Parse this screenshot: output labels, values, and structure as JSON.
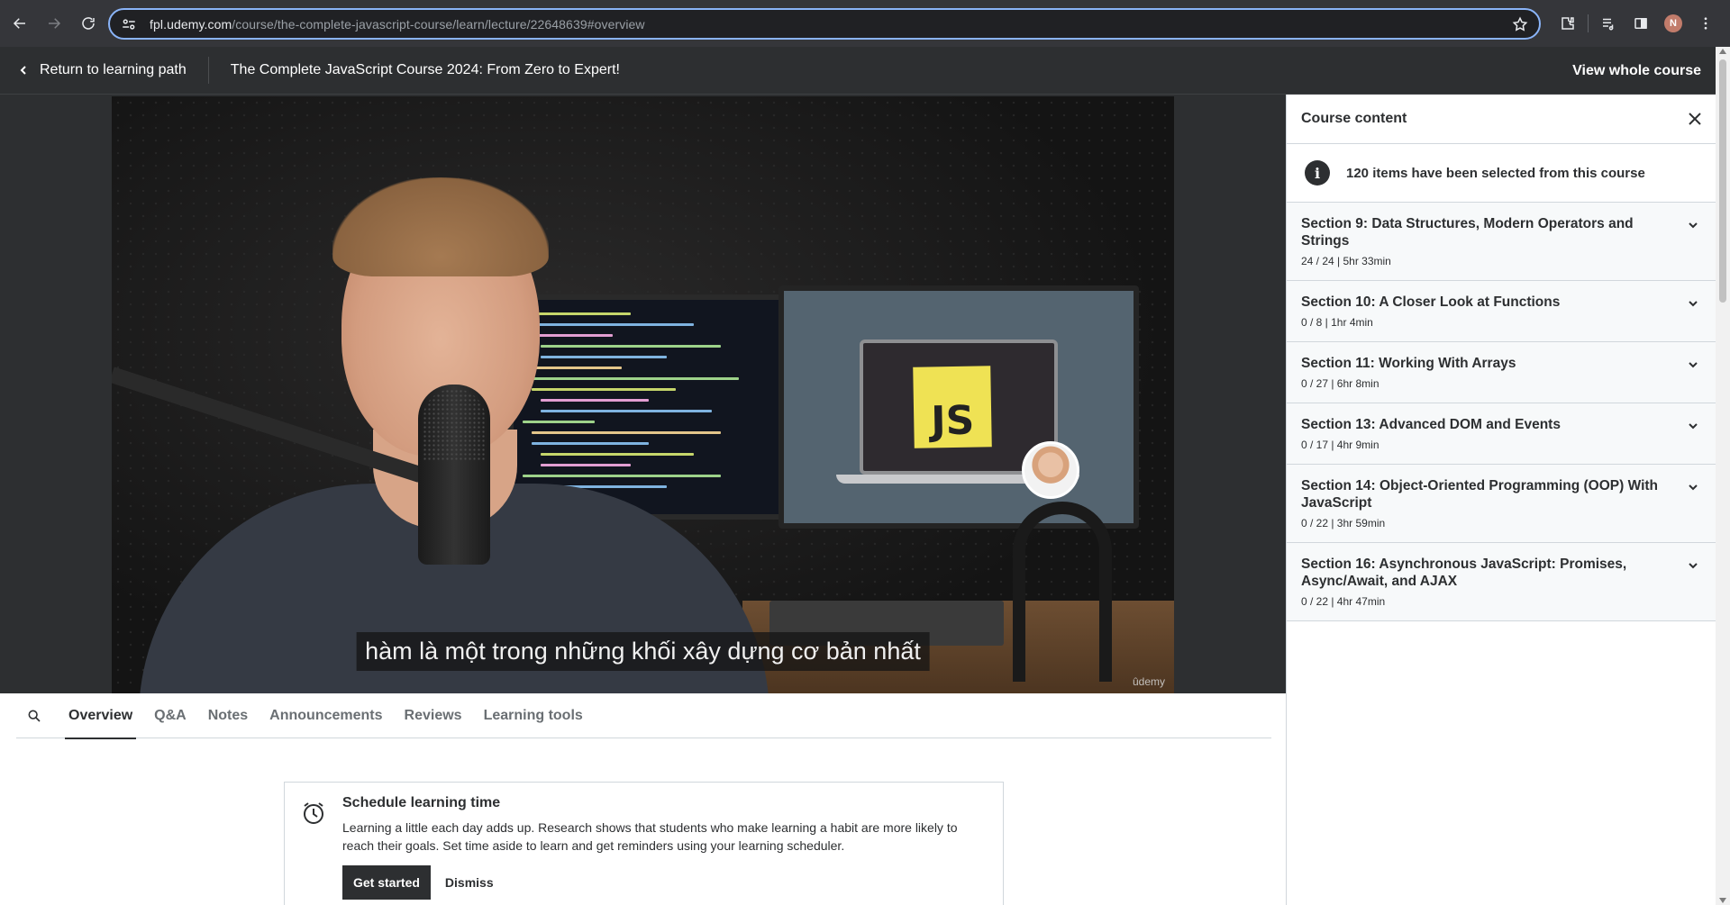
{
  "browser": {
    "url_host": "fpl.udemy.com",
    "url_path": "/course/the-complete-javascript-course/learn/lecture/22648639#overview",
    "profile_initial": "N"
  },
  "header": {
    "back_label": "Return to learning path",
    "course_title": "The Complete JavaScript Course 2024: From Zero to Expert!",
    "view_whole": "View whole course"
  },
  "video": {
    "subtitle": "hàm là một trong những khối xây dựng cơ bản nhất",
    "watermark": "ûdemy",
    "sticky_note": "JS"
  },
  "tabs": [
    {
      "label": "Overview",
      "active": true
    },
    {
      "label": "Q&A",
      "active": false
    },
    {
      "label": "Notes",
      "active": false
    },
    {
      "label": "Announcements",
      "active": false
    },
    {
      "label": "Reviews",
      "active": false
    },
    {
      "label": "Learning tools",
      "active": false
    }
  ],
  "schedule_card": {
    "title": "Schedule learning time",
    "text": "Learning a little each day adds up. Research shows that students who make learning a habit are more likely to reach their goals. Set time aside to learn and get reminders using your learning scheduler.",
    "primary_button": "Get started",
    "secondary_button": "Dismiss"
  },
  "sidebar": {
    "title": "Course content",
    "info": "120 items have been selected from this course",
    "sections": [
      {
        "title": "Section 9: Data Structures, Modern Operators and Strings",
        "meta": "24 / 24 | 5hr 33min"
      },
      {
        "title": "Section 10: A Closer Look at Functions",
        "meta": "0 / 8 | 1hr 4min"
      },
      {
        "title": "Section 11: Working With Arrays",
        "meta": "0 / 27 | 6hr 8min"
      },
      {
        "title": "Section 13: Advanced DOM and Events",
        "meta": "0 / 17 | 4hr 9min"
      },
      {
        "title": "Section 14: Object-Oriented Programming (OOP) With JavaScript",
        "meta": "0 / 22 | 3hr 59min"
      },
      {
        "title": "Section 16: Asynchronous JavaScript: Promises, Async/Await, and AJAX",
        "meta": "0 / 22 | 4hr 47min"
      }
    ]
  }
}
